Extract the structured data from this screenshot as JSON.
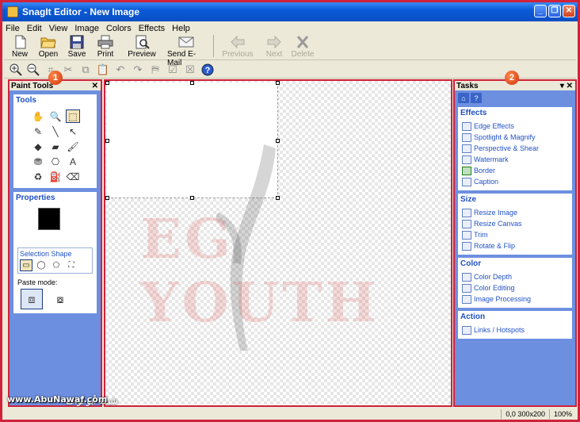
{
  "window": {
    "title": "SnagIt Editor - New Image"
  },
  "menu": [
    "File",
    "Edit",
    "View",
    "Image",
    "Colors",
    "Effects",
    "Help"
  ],
  "toolbar": {
    "new": "New",
    "open": "Open",
    "save": "Save",
    "print": "Print",
    "preview": "Preview",
    "send_email": "Send E-Mail",
    "previous": "Previous",
    "next": "Next",
    "delete": "Delete"
  },
  "left_pane": {
    "title": "Paint Tools",
    "tools_section": "Tools",
    "properties_section": "Properties",
    "selection_shape_label": "Selection Shape",
    "paste_mode_label": "Paste mode:"
  },
  "right_pane": {
    "title": "Tasks",
    "sections": [
      {
        "title": "Effects",
        "items": [
          "Edge Effects",
          "Spotlight & Magnify",
          "Perspective & Shear",
          "Watermark",
          "Border",
          "Caption"
        ]
      },
      {
        "title": "Size",
        "items": [
          "Resize Image",
          "Resize Canvas",
          "Trim",
          "Rotate & Flip"
        ]
      },
      {
        "title": "Color",
        "items": [
          "Color Depth",
          "Color Editing",
          "Image Processing"
        ]
      },
      {
        "title": "Action",
        "items": [
          "Links / Hotspots"
        ]
      }
    ]
  },
  "markers": {
    "one": "1",
    "two": "2"
  },
  "statusbar": {
    "position_size": "0,0  300x200",
    "zoom": "100%"
  },
  "watermark": {
    "text": "EG YOUTH"
  },
  "credit": {
    "url": "www.AbuNawaf.com",
    "arabic": "شبكة أبو نواف"
  },
  "colors": {
    "accent": "#d0223b",
    "pane_blue": "#6d8fe0",
    "title_blue": "#0a5ad8"
  }
}
